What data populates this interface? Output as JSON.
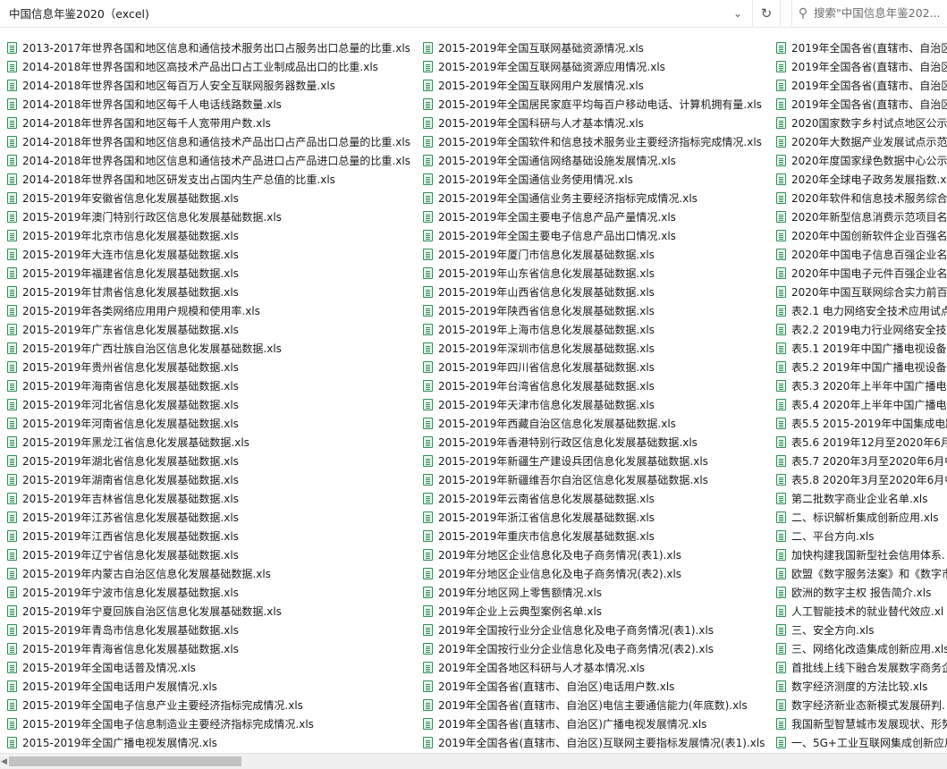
{
  "address_bar": {
    "path": "中国信息年鉴2020（excel)"
  },
  "search": {
    "placeholder": "搜索\"中国信息年鉴202..."
  },
  "icons": {
    "file": "xls-file-icon",
    "dropdown": "chevron-down-icon",
    "refresh": "refresh-icon",
    "search": "search-icon"
  },
  "colors": {
    "icon_green": "#2f8f57",
    "scrollbar_thumb": "#c2c2c2"
  },
  "columns": [
    [
      "2013-2017年世界各国和地区信息和通信技术服务出口占服务出口总量的比重.xls",
      "2014-2018年世界各国和地区高技术产品出口占工业制成品出口的比重.xls",
      "2014-2018年世界各国和地区每百万人安全互联网服务器数量.xls",
      "2014-2018年世界各国和地区每千人电话线路数量.xls",
      "2014-2018年世界各国和地区每千人宽带用户数.xls",
      "2014-2018年世界各国和地区信息和通信技术产品出口占产品出口总量的比重.xls",
      "2014-2018年世界各国和地区信息和通信技术产品进口占产品进口总量的比重.xls",
      "2014-2018年世界各国和地区研发支出占国内生产总值的比重.xls",
      "2015-2019年安徽省信息化发展基础数据.xls",
      "2015-2019年澳门特别行政区信息化发展基础数据.xls",
      "2015-2019年北京市信息化发展基础数据.xls",
      "2015-2019年大连市信息化发展基础数据.xls",
      "2015-2019年福建省信息化发展基础数据.xls",
      "2015-2019年甘肃省信息化发展基础数据.xls",
      "2015-2019年各类网络应用用户规模和使用率.xls",
      "2015-2019年广东省信息化发展基础数据.xls",
      "2015-2019年广西壮族自治区信息化发展基础数据.xls",
      "2015-2019年贵州省信息化发展基础数据.xls",
      "2015-2019年海南省信息化发展基础数据.xls",
      "2015-2019年河北省信息化发展基础数据.xls",
      "2015-2019年河南省信息化发展基础数据.xls",
      "2015-2019年黑龙江省信息化发展基础数据.xls",
      "2015-2019年湖北省信息化发展基础数据.xls",
      "2015-2019年湖南省信息化发展基础数据.xls",
      "2015-2019年吉林省信息化发展基础数据.xls",
      "2015-2019年江苏省信息化发展基础数据.xls",
      "2015-2019年江西省信息化发展基础数据.xls",
      "2015-2019年辽宁省信息化发展基础数据.xls",
      "2015-2019年内蒙古自治区信息化发展基础数据.xls",
      "2015-2019年宁波市信息化发展基础数据.xls",
      "2015-2019年宁夏回族自治区信息化发展基础数据.xls",
      "2015-2019年青岛市信息化发展基础数据.xls",
      "2015-2019年青海省信息化发展基础数据.xls",
      "2015-2019年全国电话普及情况.xls",
      "2015-2019年全国电话用户发展情况.xls",
      "2015-2019年全国电子信息产业主要经济指标完成情况.xls",
      "2015-2019年全国电子信息制造业主要经济指标完成情况.xls",
      "2015-2019年全国广播电视发展情况.xls"
    ],
    [
      "2015-2019年全国互联网基础资源情况.xls",
      "2015-2019年全国互联网基础资源应用情况.xls",
      "2015-2019年全国互联网用户发展情况.xls",
      "2015-2019年全国居民家庭平均每百户移动电话、计算机拥有量.xls",
      "2015-2019年全国科研与人才基本情况.xls",
      "2015-2019年全国软件和信息技术服务业主要经济指标完成情况.xls",
      "2015-2019年全国通信网络基础设施发展情况.xls",
      "2015-2019年全国通信业务使用情况.xls",
      "2015-2019年全国通信业务主要经济指标完成情况.xls",
      "2015-2019年全国主要电子信息产品产量情况.xls",
      "2015-2019年全国主要电子信息产品出口情况.xls",
      "2015-2019年厦门市信息化发展基础数据.xls",
      "2015-2019年山东省信息化发展基础数据.xls",
      "2015-2019年山西省信息化发展基础数据.xls",
      "2015-2019年陕西省信息化发展基础数据.xls",
      "2015-2019年上海市信息化发展基础数据.xls",
      "2015-2019年深圳市信息化发展基础数据.xls",
      "2015-2019年四川省信息化发展基础数据.xls",
      "2015-2019年台湾省信息化发展基础数据.xls",
      "2015-2019年天津市信息化发展基础数据.xls",
      "2015-2019年西藏自治区信息化发展基础数据.xls",
      "2015-2019年香港特别行政区信息化发展基础数据.xls",
      "2015-2019年新疆生产建设兵团信息化发展基础数据.xls",
      "2015-2019年新疆维吾尔自治区信息化发展基础数据.xls",
      "2015-2019年云南省信息化发展基础数据.xls",
      "2015-2019年浙江省信息化发展基础数据.xls",
      "2015-2019年重庆市信息化发展基础数据.xls",
      "2019年分地区企业信息化及电子商务情况(表1).xls",
      "2019年分地区企业信息化及电子商务情况(表2).xls",
      "2019年分地区网上零售额情况.xls",
      "2019年企业上云典型案例名单.xls",
      "2019年全国按行业分企业信息化及电子商务情况(表1).xls",
      "2019年全国按行业分企业信息化及电子商务情况(表2).xls",
      "2019年全国各地区科研与人才基本情况.xls",
      "2019年全国各省(直辖市、自治区)电话用户数.xls",
      "2019年全国各省(直辖市、自治区)电信主要通信能力(年底数).xls",
      "2019年全国各省(直辖市、自治区)广播电视发展情况.xls",
      "2019年全国各省(直辖市、自治区)互联网主要指标发展情况(表1).xls"
    ],
    [
      "2019年全国各省(直辖市、自治区",
      "2019年全国各省(直辖市、自治区",
      "2019年全国各省(直辖市、自治区",
      "2019年全国各省(直辖市、自治区",
      "2020国家数字乡村试点地区公示",
      "2020年大数据产业发展试点示范",
      "2020年度国家绿色数据中心公示",
      "2020年全球电子政务发展指数.xl",
      "2020年软件和信息技术服务综合",
      "2020年新型信息消费示范项目名",
      "2020年中国创新软件企业百强名",
      "2020年中国电子信息百强企业名",
      "2020年中国电子元件百强企业名",
      "2020年中国互联网综合实力前百",
      "表2.1 电力网络安全技术应用试点",
      "表2.2 2019电力行业网络安全技",
      "表5.1 2019年中国广播电视设备",
      "表5.2 2019年中国广播电视设备",
      "表5.3 2020年上半年中国广播电",
      "表5.4 2020年上半年中国广播电",
      "表5.5 2015-2019年中国集成电路",
      "表5.6 2019年12月至2020年6月中",
      "表5.7 2020年3月至2020年6月中",
      "表5.8 2020年3月至2020年6月中",
      "第二批数字商业企业名单.xls",
      "二、标识解析集成创新应用.xls",
      "二、平台方向.xls",
      "加快构建我国新型社会信用体系.",
      "欧盟《数字服务法案》和《数字市",
      "欧洲的数字主权 报告简介.xls",
      "人工智能技术的就业替代效应.xl",
      "三、安全方向.xls",
      "三、网络化改造集成创新应用.xls",
      "首批线上线下融合发展数字商务企",
      "数字经济测度的方法比较.xls",
      "数字经济新业态新模式发展研判.",
      "我国新型智慧城市发展现状、形势",
      "一、5G+工业互联网集成创新应用"
    ]
  ]
}
